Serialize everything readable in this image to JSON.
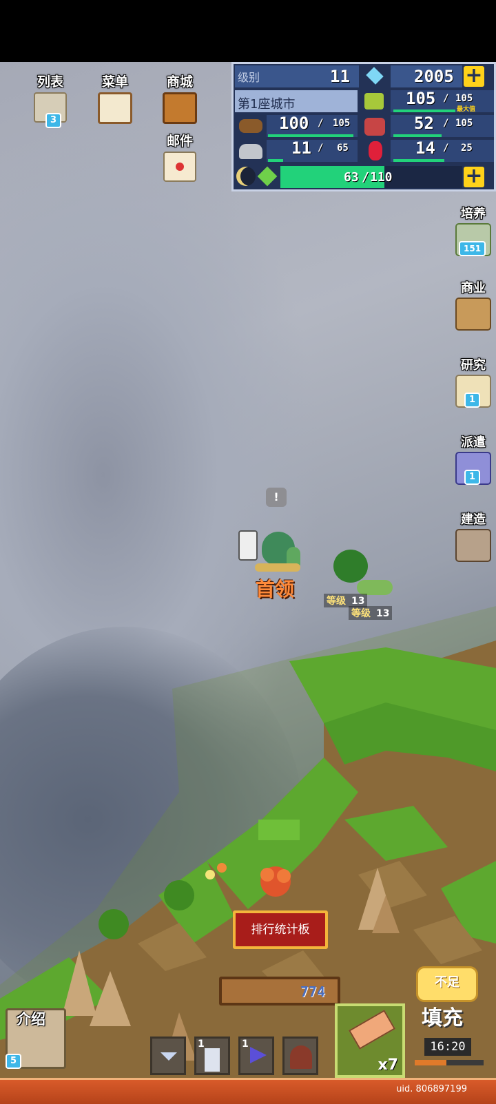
{
  "top_menu": {
    "list": {
      "label": "列表",
      "badge": "3"
    },
    "menu": {
      "label": "菜单"
    },
    "shop": {
      "label": "商城"
    },
    "mail": {
      "label": "邮件"
    }
  },
  "stats": {
    "level_label": "级别",
    "level": "11",
    "gems": "2005",
    "city_name": "第1座城市",
    "food": {
      "value": "105",
      "max": "105",
      "note": "最大值"
    },
    "wood": {
      "value": "100",
      "max": "105"
    },
    "meat": {
      "value": "52",
      "max": "105"
    },
    "stone": {
      "value": "11",
      "max": "65"
    },
    "ruby": {
      "value": "14",
      "max": "25"
    },
    "energy": {
      "value": "63",
      "max": "110"
    }
  },
  "right_menu": {
    "train": {
      "label": "培养",
      "badge": "151"
    },
    "business": {
      "label": "商业"
    },
    "research": {
      "label": "研究",
      "badge": "1"
    },
    "dispatch": {
      "label": "派遣",
      "badge": "1"
    },
    "build": {
      "label": "建造"
    }
  },
  "map": {
    "boss_label": "首领",
    "level_prefix": "等级",
    "monster1_level": "13",
    "monster2_level": "13"
  },
  "bottom": {
    "ranking_button": "排行统计板",
    "sign_value": "774",
    "intro_label": "介绍",
    "intro_badge": "5",
    "slot_tower_count": "1",
    "slot_flag_count": "1",
    "hammer_count": "x7",
    "refill_top": "不足",
    "refill_label": "填充",
    "refill_timer": "16:20",
    "uid": "uid. 806897199"
  },
  "colors": {
    "panel_bg": "#233256",
    "energy_green": "#22d27a",
    "gold": "#ffd21a",
    "boss_orange": "#ff8a3a",
    "bottom_bar": "#d95b2a"
  }
}
